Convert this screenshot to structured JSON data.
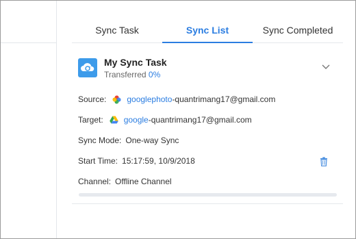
{
  "tabs": [
    {
      "label": "Sync Task"
    },
    {
      "label": "Sync List",
      "active": true
    },
    {
      "label": "Sync Completed"
    }
  ],
  "task": {
    "title": "My Sync Task",
    "transferred_label": "Transferred",
    "transferred_pct": "0%",
    "progress_fraction": 0.0
  },
  "details": {
    "source_label": "Source:",
    "source_service": "googlephoto",
    "source_account": "-quantrimang17@gmail.com",
    "target_label": "Target:",
    "target_service": "google",
    "target_account": "-quantrimang17@gmail.com",
    "mode_label": "Sync Mode:",
    "mode_value": "One-way Sync",
    "start_label": "Start Time:",
    "start_value": "15:17:59, 10/9/2018",
    "channel_label": "Channel:",
    "channel_value": "Offline Channel"
  },
  "icons": {
    "task": "cloud-sync-icon",
    "chevron": "chevron-down-icon",
    "delete": "trash-icon",
    "source": "google-photos-icon",
    "target": "google-drive-icon"
  },
  "colors": {
    "accent": "#2b7de1",
    "task_icon_bg": "#3d9bea"
  }
}
